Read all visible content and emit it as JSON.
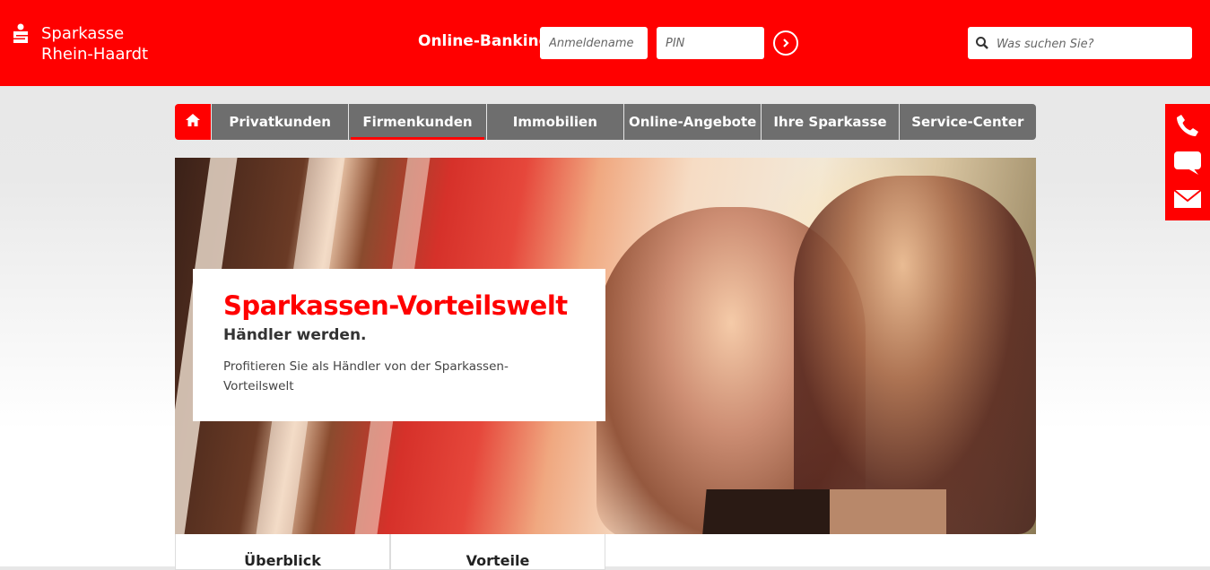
{
  "header": {
    "logo_line1": "Sparkasse",
    "logo_line2": "Rhein-Haardt",
    "online_banking_label": "Online-Banking",
    "username_placeholder": "Anmeldename",
    "pin_placeholder": "PIN",
    "search_placeholder": "Was suchen Sie?"
  },
  "nav": {
    "items": [
      {
        "label": "Privatkunden"
      },
      {
        "label": "Firmenkunden"
      },
      {
        "label": "Immobilien"
      },
      {
        "label": "Online-Angebote"
      },
      {
        "label": "Ihre Sparkasse"
      },
      {
        "label": "Service-Center"
      }
    ],
    "active": "Firmenkunden"
  },
  "side_contact": {
    "icons": [
      "phone-icon",
      "chat-icon",
      "mail-icon"
    ]
  },
  "hero": {
    "title": "Sparkassen-Vorteilswelt",
    "subtitle": "Händler werden.",
    "text": "Profitieren Sie als Händler von der Sparkassen-Vorteilswelt"
  },
  "tabs": [
    {
      "label": "Überblick"
    },
    {
      "label": "Vorteile"
    }
  ],
  "colors": {
    "brand_red": "#ff0000",
    "nav_gray": "#6e6e6e"
  }
}
